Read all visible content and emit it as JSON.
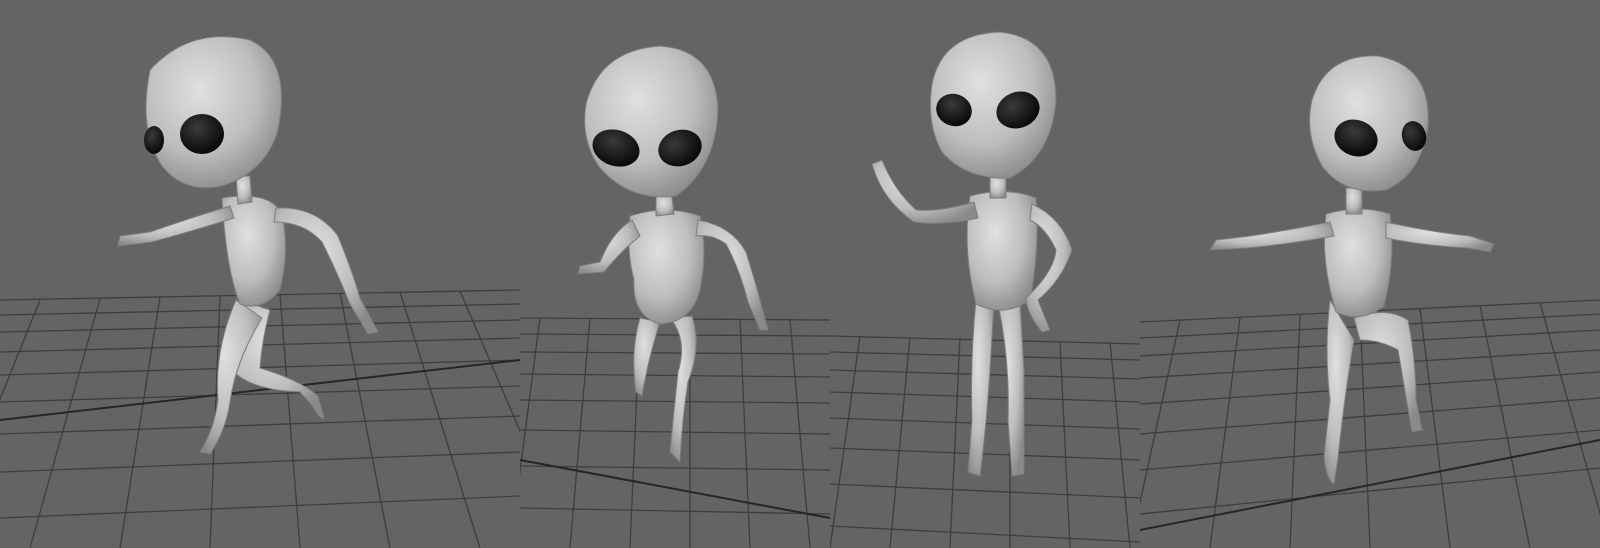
{
  "panels": [
    {
      "id": "pose-1",
      "pose": "running-leap"
    },
    {
      "id": "pose-2",
      "pose": "walking-step"
    },
    {
      "id": "pose-3",
      "pose": "waving-hand-on-hip"
    },
    {
      "id": "pose-4",
      "pose": "balancing-one-leg"
    }
  ],
  "colors": {
    "background": "#646464",
    "grid_line": "#3d3d3d",
    "grid_axis": "#222222",
    "skin": "#c9c9c9",
    "skin_shadow": "#8f8f8f",
    "eye": "#0b0b0b"
  }
}
